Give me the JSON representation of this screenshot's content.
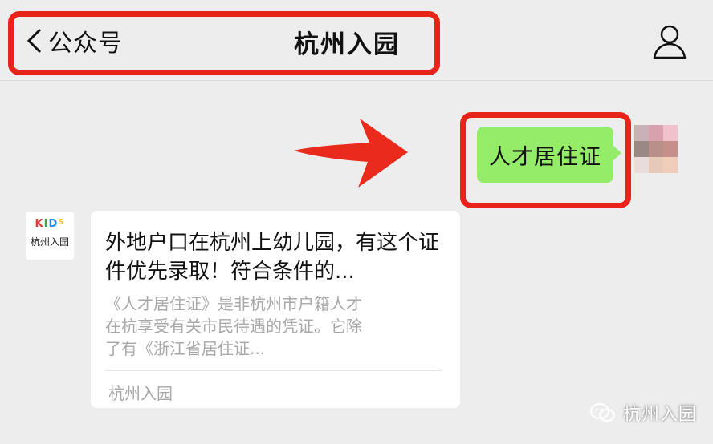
{
  "header": {
    "back_label": "公众号",
    "title": "杭州入园",
    "back_icon": "chevron-left-icon",
    "profile_icon": "person-icon"
  },
  "colors": {
    "highlight": "#e8231a",
    "bubble_green": "#95ec69",
    "background": "#ededed"
  },
  "chat": {
    "user_message": "人才居住证",
    "bot_avatar": {
      "logo_letters": [
        "K",
        "I",
        "D",
        "S"
      ],
      "name": "杭州入园"
    },
    "article": {
      "title": "外地户口在杭州上幼儿园，有这个证件优先录取！符合条件的...",
      "description": "《人才居住证》是非杭州市户籍人才在杭享受有关市民待遇的凭证。它除了有《浙江省居住证...",
      "source": "杭州入园"
    }
  },
  "watermark": {
    "text": "杭州入园",
    "icon": "wechat-icon"
  }
}
